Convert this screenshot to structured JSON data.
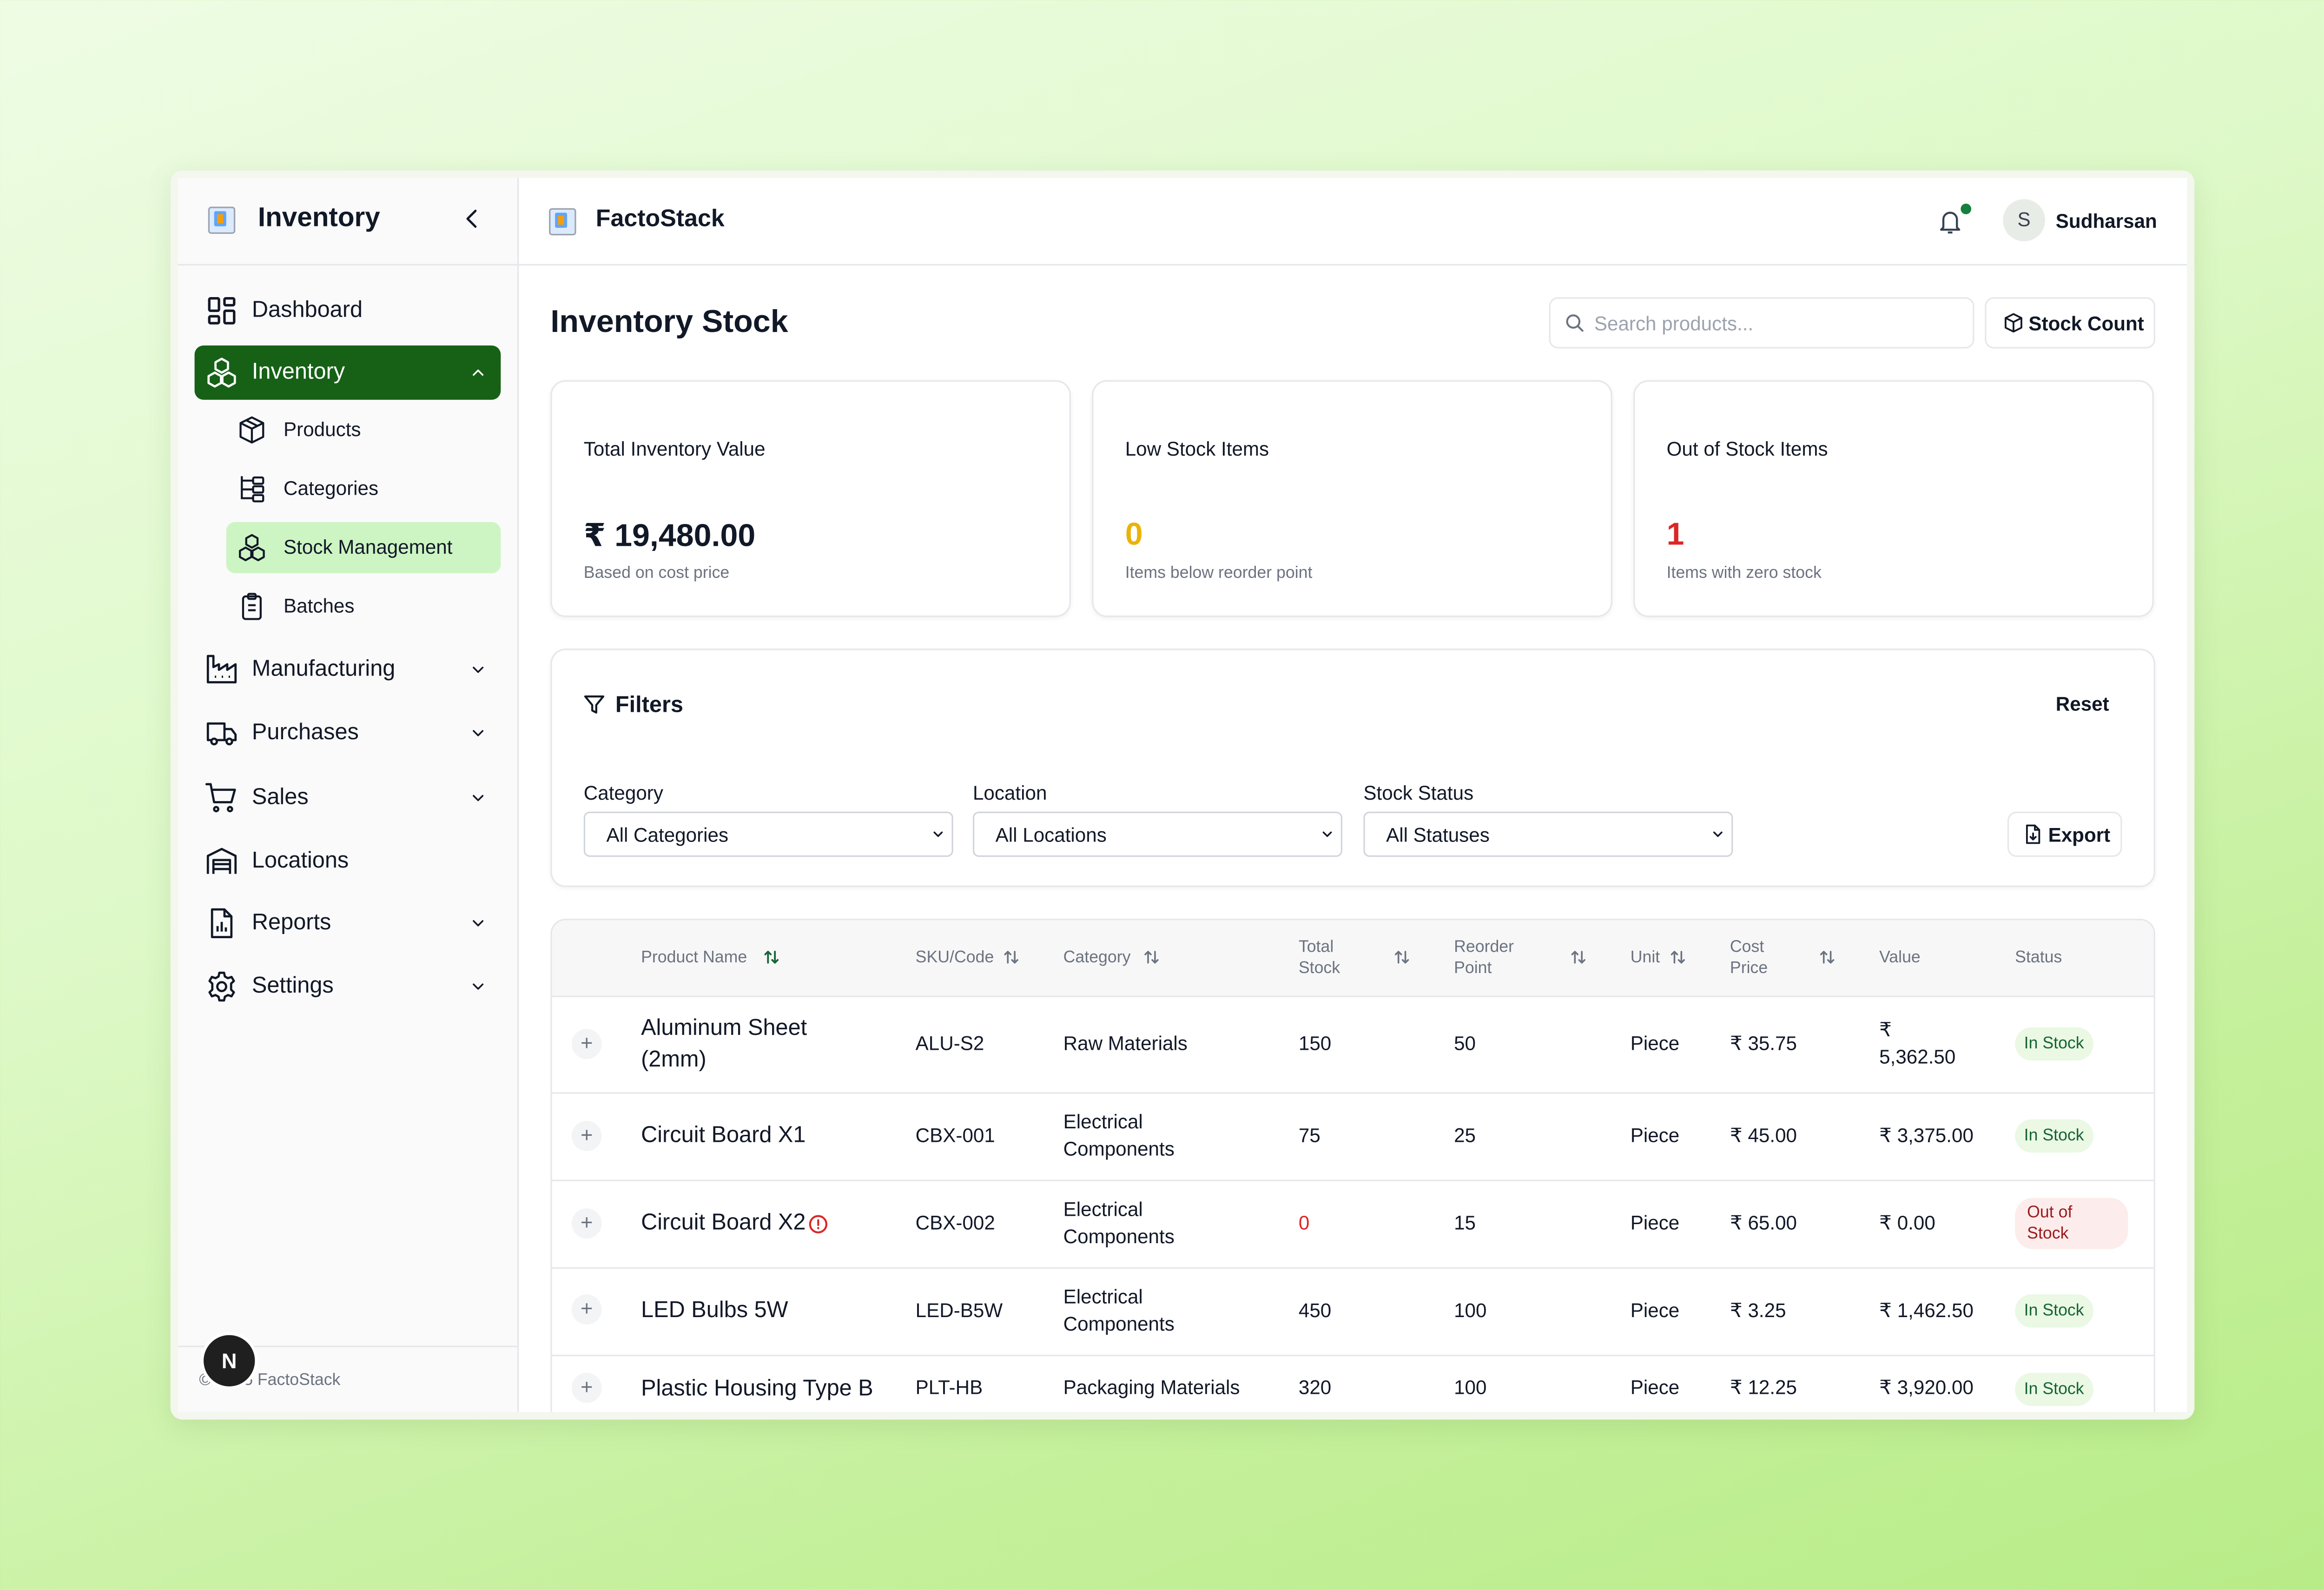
{
  "colors": {
    "brand": "#166116",
    "brand_light": "#cdf5c3",
    "warning": "#f59e0b",
    "danger": "#dc2626",
    "success_bg": "#eaf8e4"
  },
  "sidebar": {
    "title": "Inventory",
    "items": [
      {
        "label": "Dashboard",
        "icon": "dashboard-icon"
      },
      {
        "label": "Inventory",
        "icon": "boxes-icon",
        "expanded": true,
        "active": true
      },
      {
        "label": "Manufacturing",
        "icon": "factory-icon"
      },
      {
        "label": "Purchases",
        "icon": "truck-icon"
      },
      {
        "label": "Sales",
        "icon": "cart-icon"
      },
      {
        "label": "Locations",
        "icon": "warehouse-icon"
      },
      {
        "label": "Reports",
        "icon": "report-icon"
      },
      {
        "label": "Settings",
        "icon": "gear-icon"
      }
    ],
    "subitems": [
      {
        "label": "Products",
        "icon": "package-icon"
      },
      {
        "label": "Categories",
        "icon": "tree-icon"
      },
      {
        "label": "Stock Management",
        "icon": "boxes-icon",
        "active": true
      },
      {
        "label": "Batches",
        "icon": "clipboard-icon"
      }
    ],
    "footer": "© 2025 FactoStack",
    "dev_badge": "N"
  },
  "topbar": {
    "brand": "FactoStack",
    "user_initial": "S",
    "user_name": "Sudharsan"
  },
  "page": {
    "title": "Inventory Stock",
    "search_placeholder": "Search products...",
    "stock_count_label": "Stock Count"
  },
  "cards": [
    {
      "title": "Total Inventory Value",
      "value": "₹ 19,480.00",
      "desc": "Based on cost price"
    },
    {
      "title": "Low Stock Items",
      "value": "0",
      "desc": "Items below reorder point"
    },
    {
      "title": "Out of Stock Items",
      "value": "1",
      "desc": "Items with zero stock"
    }
  ],
  "filters": {
    "title": "Filters",
    "reset": "Reset",
    "category_label": "Category",
    "category_value": "All Categories",
    "location_label": "Location",
    "location_value": "All Locations",
    "status_label": "Stock Status",
    "status_value": "All Statuses",
    "export": "Export"
  },
  "table": {
    "headers": {
      "name": "Product Name",
      "sku": "SKU/Code",
      "category": "Category",
      "total_stock_1": "Total",
      "total_stock_2": "Stock",
      "reorder_1": "Reorder",
      "reorder_2": "Point",
      "unit": "Unit",
      "cost_1": "Cost",
      "cost_2": "Price",
      "value": "Value",
      "status": "Status"
    },
    "rows": [
      {
        "name_1": "Aluminum Sheet",
        "name_2": "(2mm)",
        "sku": "ALU-S2",
        "category_1": "Raw Materials",
        "category_2": "",
        "stock": "150",
        "reorder": "50",
        "unit": "Piece",
        "cost": "₹ 35.75",
        "value_1": "₹",
        "value_2": "5,362.50",
        "status": "In Stock"
      },
      {
        "name_1": "Circuit Board X1",
        "name_2": "",
        "sku": "CBX-001",
        "category_1": "Electrical",
        "category_2": "Components",
        "stock": "75",
        "reorder": "25",
        "unit": "Piece",
        "cost": "₹ 45.00",
        "value_1": "₹ 3,375.00",
        "value_2": "",
        "status": "In Stock"
      },
      {
        "name_1": "Circuit Board X2",
        "name_2": "",
        "sku": "CBX-002",
        "category_1": "Electrical",
        "category_2": "Components",
        "stock": "0",
        "reorder": "15",
        "unit": "Piece",
        "cost": "₹ 65.00",
        "value_1": "₹ 0.00",
        "value_2": "",
        "status_1": "Out of",
        "status_2": "Stock"
      },
      {
        "name_1": "LED Bulbs 5W",
        "name_2": "",
        "sku": "LED-B5W",
        "category_1": "Electrical",
        "category_2": "Components",
        "stock": "450",
        "reorder": "100",
        "unit": "Piece",
        "cost": "₹ 3.25",
        "value_1": "₹ 1,462.50",
        "value_2": "",
        "status": "In Stock"
      },
      {
        "name_1": "Plastic Housing Type B",
        "name_2": "",
        "sku": "PLT-HB",
        "category_1": "Packaging Materials",
        "category_2": "",
        "stock": "320",
        "reorder": "100",
        "unit": "Piece",
        "cost": "₹ 12.25",
        "value_1": "₹ 3,920.00",
        "value_2": "",
        "status": "In Stock"
      }
    ]
  }
}
